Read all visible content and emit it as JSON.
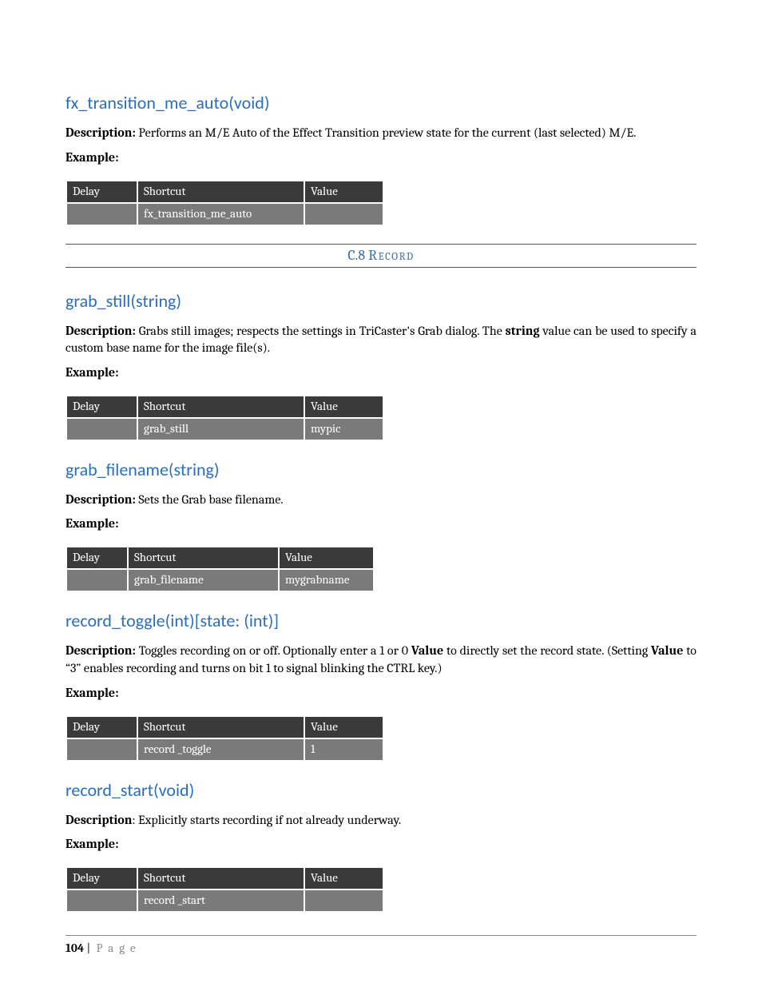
{
  "section_header": {
    "number": "C.8",
    "title": "Record"
  },
  "functions": [
    {
      "name": "fx_transition_me_auto(void)",
      "description_html": "<strong>Description:</strong> Performs an M/E Auto of the Effect Transition preview state for the current (last selected) M/E.",
      "example_label": "Example:",
      "table": {
        "headers": [
          "Delay",
          "Shortcut",
          "Value"
        ],
        "row": [
          "",
          "fx_transition_me_auto",
          ""
        ],
        "widths": [
          70,
          190,
          80
        ]
      },
      "after_section": true
    },
    {
      "name": "grab_still(string)",
      "description_html": "<strong>Description:</strong> Grabs still images; respects the settings in TriCaster's Grab dialog. The <strong>string</strong> value can be used to specify a custom base name for the image file(s).",
      "example_label": "Example:",
      "table": {
        "headers": [
          "Delay",
          "Shortcut",
          "Value"
        ],
        "row": [
          "",
          "grab_still",
          "mypic"
        ],
        "widths": [
          70,
          190,
          80
        ]
      }
    },
    {
      "name": "grab_filename(string)",
      "description_html": "<strong>Description:</strong> Sets the Grab base filename.",
      "example_label": "Example:",
      "table": {
        "headers": [
          "Delay",
          "Shortcut",
          "Value"
        ],
        "row": [
          "",
          "grab_filename",
          "mygrabname"
        ],
        "widths": [
          58,
          170,
          100
        ]
      }
    },
    {
      "name": "record_toggle(int)[state: (int)]",
      "description_html": "<strong>Description:</strong> Toggles recording on or off. Optionally enter a 1 or 0 <strong>Value</strong> to directly set the record state. (Setting <strong>Value</strong> to “3” enables recording and turns on bit 1 to signal blinking the CTRL key.)",
      "example_label": "Example:",
      "table": {
        "headers": [
          "Delay",
          "Shortcut",
          "Value"
        ],
        "row": [
          "",
          "record _toggle",
          "1"
        ],
        "widths": [
          70,
          190,
          80
        ]
      }
    },
    {
      "name": "record_start(void)",
      "description_html": "<strong>Description</strong>: Explicitly starts recording if not already underway.",
      "example_label": "Example:",
      "table": {
        "headers": [
          "Delay",
          "Shortcut",
          "Value"
        ],
        "row": [
          "",
          "record _start",
          ""
        ],
        "widths": [
          70,
          190,
          80
        ]
      }
    }
  ],
  "footer": {
    "page_number": "104",
    "separator": " | ",
    "label": "Page"
  }
}
